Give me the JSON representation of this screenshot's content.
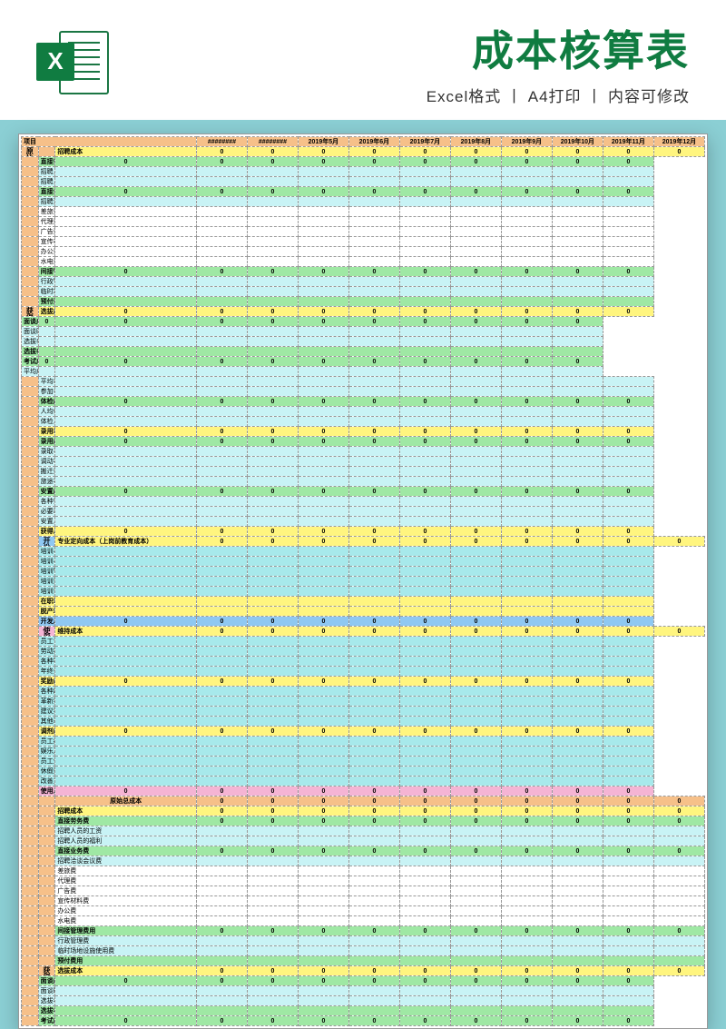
{
  "header": {
    "main_title": "成本核算表",
    "subtitle_parts": [
      "Excel格式",
      "A4打印",
      "内容可修改"
    ],
    "badge": "X"
  },
  "columns": {
    "item_header": "项目",
    "months": [
      "########",
      "########",
      "2019年5月",
      "2019年6月",
      "2019年7月",
      "2019年8月",
      "2019年9月",
      "2019年10月",
      "2019年11月",
      "2019年12月"
    ]
  },
  "side_labels": {
    "primary1": "原始成本",
    "acq": "获得成本",
    "dev": "开发成本",
    "use": "使用成本",
    "acq2": "获得成本"
  },
  "sections": [
    {
      "style": "yellow",
      "bold": true,
      "zeros": true,
      "label": "招聘成本"
    },
    {
      "style": "green",
      "bold": true,
      "zeros": true,
      "label": "直接劳务费"
    },
    {
      "style": "cyan",
      "bold": false,
      "zeros": false,
      "label": "招聘人员的工资"
    },
    {
      "style": "cyan",
      "bold": false,
      "zeros": false,
      "label": "招聘人员的福利"
    },
    {
      "style": "green",
      "bold": true,
      "zeros": true,
      "label": "直接业务费"
    },
    {
      "style": "cyan",
      "bold": false,
      "zeros": false,
      "label": "招聘洽谈会议费"
    },
    {
      "style": "plain",
      "bold": false,
      "zeros": false,
      "label": "差旅费"
    },
    {
      "style": "plain",
      "bold": false,
      "zeros": false,
      "label": "代理费"
    },
    {
      "style": "plain",
      "bold": false,
      "zeros": false,
      "label": "广告费"
    },
    {
      "style": "plain",
      "bold": false,
      "zeros": false,
      "label": "宣传材料费"
    },
    {
      "style": "plain",
      "bold": false,
      "zeros": false,
      "label": "办公费"
    },
    {
      "style": "plain",
      "bold": false,
      "zeros": false,
      "label": "水电费"
    },
    {
      "style": "green",
      "bold": true,
      "zeros": true,
      "label": "间接管理费用"
    },
    {
      "style": "cyan",
      "bold": false,
      "zeros": false,
      "label": "行政管理费"
    },
    {
      "style": "cyan",
      "bold": false,
      "zeros": false,
      "label": "临时场地设施使用费"
    },
    {
      "style": "green",
      "bold": true,
      "zeros": false,
      "label": "预付费用"
    },
    {
      "style": "yellow",
      "bold": true,
      "zeros": true,
      "label": "选拔成本"
    },
    {
      "style": "green",
      "bold": true,
      "zeros": true,
      "label": "面谈成本"
    },
    {
      "style": "cyan",
      "bold": false,
      "zeros": false,
      "label": "面谈时间"
    },
    {
      "style": "cyan",
      "bold": false,
      "zeros": false,
      "label": "选拔者单位工资"
    },
    {
      "style": "green",
      "bold": true,
      "zeros": false,
      "label": "选拔者人数"
    },
    {
      "style": "green",
      "bold": true,
      "zeros": true,
      "label": "考试成本"
    },
    {
      "style": "cyan",
      "bold": false,
      "zeros": false,
      "label": "平均成本的材料费用"
    },
    {
      "style": "cyan",
      "bold": false,
      "zeros": false,
      "label": "平均每人的考试和评分时间成本"
    },
    {
      "style": "cyan",
      "bold": false,
      "zeros": false,
      "label": "参加考试的人次数"
    },
    {
      "style": "green",
      "bold": true,
      "zeros": true,
      "label": "体检成本"
    },
    {
      "style": "cyan",
      "bold": false,
      "zeros": false,
      "label": "人均体检费用"
    },
    {
      "style": "cyan",
      "bold": false,
      "zeros": false,
      "label": "体检人数"
    },
    {
      "style": "yellow",
      "bold": true,
      "zeros": true,
      "label": "录用和安置成本"
    },
    {
      "style": "green",
      "bold": true,
      "zeros": true,
      "label": "录用成本"
    },
    {
      "style": "cyan",
      "bold": false,
      "zeros": false,
      "label": "录取手续费"
    },
    {
      "style": "cyan",
      "bold": false,
      "zeros": false,
      "label": "调动补偿费"
    },
    {
      "style": "cyan",
      "bold": false,
      "zeros": false,
      "label": "搬迁费"
    },
    {
      "style": "cyan",
      "bold": false,
      "zeros": false,
      "label": "旅途补助费"
    },
    {
      "style": "green",
      "bold": true,
      "zeros": true,
      "label": "安置成本"
    },
    {
      "style": "cyan",
      "bold": false,
      "zeros": false,
      "label": "各种安置行政费用"
    },
    {
      "style": "cyan",
      "bold": false,
      "zeros": false,
      "label": "必要装备费"
    },
    {
      "style": "cyan",
      "bold": false,
      "zeros": false,
      "label": "安置人员时间损失成本"
    },
    {
      "style": "yellow",
      "bold": true,
      "zeros": true,
      "label": "获得总成本"
    },
    {
      "style": "yellow",
      "bold": true,
      "zeros": true,
      "label": "专业定向成本（上岗前教育成本）"
    },
    {
      "style": "cyan2",
      "bold": false,
      "zeros": false,
      "label": "培训与受训人员的工资"
    },
    {
      "style": "cyan2",
      "bold": false,
      "zeros": false,
      "label": "培训与受训人员离岗的损失费用"
    },
    {
      "style": "cyan2",
      "bold": false,
      "zeros": false,
      "label": "培训管理费用"
    },
    {
      "style": "cyan2",
      "bold": false,
      "zeros": false,
      "label": "培训资料费用"
    },
    {
      "style": "cyan2",
      "bold": false,
      "zeros": false,
      "label": "培训设备折旧费用"
    },
    {
      "style": "yellow",
      "bold": true,
      "zeros": false,
      "label": "在职培训成本（岗位培训成本）"
    },
    {
      "style": "yellow",
      "bold": true,
      "zeros": false,
      "label": "脱产培训成本"
    },
    {
      "style": "blue",
      "bold": true,
      "zeros": true,
      "label": "开发总成本"
    },
    {
      "style": "yellow",
      "bold": true,
      "zeros": true,
      "label": "维持成本"
    },
    {
      "style": "cyan2",
      "bold": false,
      "zeros": false,
      "label": "员工计时或计件工资"
    },
    {
      "style": "cyan2",
      "bold": false,
      "zeros": false,
      "label": "劳动报酬性津贴"
    },
    {
      "style": "cyan2",
      "bold": false,
      "zeros": false,
      "label": "各种福利费用"
    },
    {
      "style": "cyan2",
      "bold": false,
      "zeros": false,
      "label": "年终分红"
    },
    {
      "style": "yellow",
      "bold": true,
      "zeros": true,
      "label": "奖励成本"
    },
    {
      "style": "cyan2",
      "bold": false,
      "zeros": false,
      "label": "各种超产奖"
    },
    {
      "style": "cyan2",
      "bold": false,
      "zeros": false,
      "label": "革新奖"
    },
    {
      "style": "cyan2",
      "bold": false,
      "zeros": false,
      "label": "建议奖"
    },
    {
      "style": "cyan2",
      "bold": false,
      "zeros": false,
      "label": "其他表彰支出"
    },
    {
      "style": "yellow",
      "bold": true,
      "zeros": true,
      "label": "调剂成本"
    },
    {
      "style": "cyan2",
      "bold": false,
      "zeros": false,
      "label": "员工疗养费用"
    },
    {
      "style": "cyan2",
      "bold": false,
      "zeros": false,
      "label": "娱乐及文体活动费用"
    },
    {
      "style": "cyan2",
      "bold": false,
      "zeros": false,
      "label": "员工业余社团开支"
    },
    {
      "style": "cyan2",
      "bold": false,
      "zeros": false,
      "label": "休假费用"
    },
    {
      "style": "cyan2",
      "bold": false,
      "zeros": false,
      "label": "改善工作环境的费用"
    },
    {
      "style": "pink",
      "bold": true,
      "zeros": true,
      "label": "使用总成本"
    },
    {
      "style": "orange",
      "bold": true,
      "zeros": true,
      "label": "原始总成本",
      "center": true
    },
    {
      "style": "yellow",
      "bold": true,
      "zeros": true,
      "label": "招聘成本"
    },
    {
      "style": "green",
      "bold": true,
      "zeros": true,
      "label": "直接劳务费"
    },
    {
      "style": "cyan",
      "bold": false,
      "zeros": false,
      "label": "招聘人员的工资"
    },
    {
      "style": "cyan",
      "bold": false,
      "zeros": false,
      "label": "招聘人员的福利"
    },
    {
      "style": "green",
      "bold": true,
      "zeros": true,
      "label": "直接业务费"
    },
    {
      "style": "cyan",
      "bold": false,
      "zeros": false,
      "label": "招聘洽谈会议费"
    },
    {
      "style": "plain",
      "bold": false,
      "zeros": false,
      "label": "差旅费"
    },
    {
      "style": "plain",
      "bold": false,
      "zeros": false,
      "label": "代理费"
    },
    {
      "style": "plain",
      "bold": false,
      "zeros": false,
      "label": "广告费"
    },
    {
      "style": "plain",
      "bold": false,
      "zeros": false,
      "label": "宣传材料费"
    },
    {
      "style": "plain",
      "bold": false,
      "zeros": false,
      "label": "办公费"
    },
    {
      "style": "plain",
      "bold": false,
      "zeros": false,
      "label": "水电费"
    },
    {
      "style": "green",
      "bold": true,
      "zeros": true,
      "label": "间接管理费用"
    },
    {
      "style": "cyan",
      "bold": false,
      "zeros": false,
      "label": "行政管理费"
    },
    {
      "style": "cyan",
      "bold": false,
      "zeros": false,
      "label": "临时场地设施使用费"
    },
    {
      "style": "green",
      "bold": true,
      "zeros": false,
      "label": "预付费用"
    },
    {
      "style": "yellow",
      "bold": true,
      "zeros": true,
      "label": "选拔成本"
    },
    {
      "style": "green",
      "bold": true,
      "zeros": true,
      "label": "面谈成本"
    },
    {
      "style": "cyan",
      "bold": false,
      "zeros": false,
      "label": "面谈时间"
    },
    {
      "style": "cyan",
      "bold": false,
      "zeros": false,
      "label": "选拔者单位工资"
    },
    {
      "style": "green",
      "bold": true,
      "zeros": false,
      "label": "选拔者人数"
    },
    {
      "style": "green",
      "bold": true,
      "zeros": true,
      "label": "考试成本"
    }
  ]
}
